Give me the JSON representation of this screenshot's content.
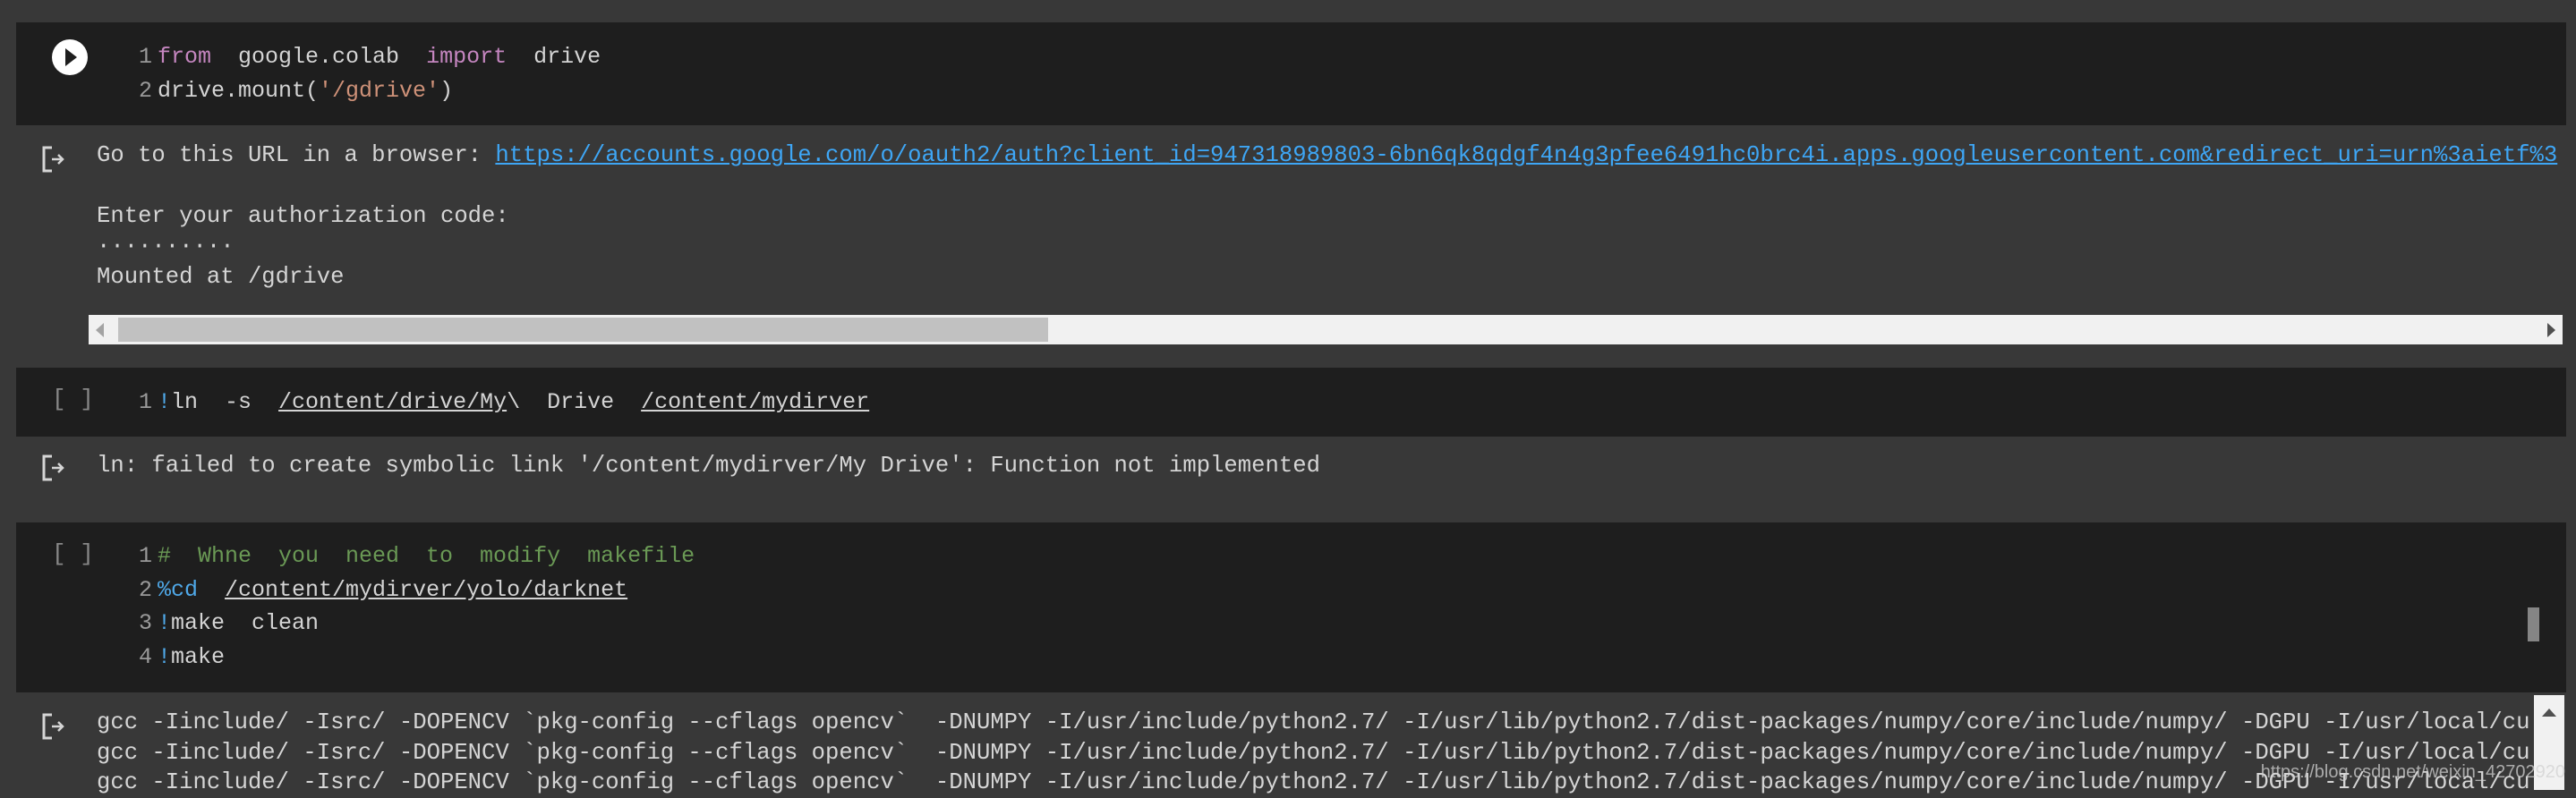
{
  "cells": [
    {
      "state": "run",
      "lines": [
        {
          "n": "1",
          "parts": [
            {
              "t": "from",
              "c": "kw"
            },
            {
              "t": "  google.colab  "
            },
            {
              "t": "import",
              "c": "kw"
            },
            {
              "t": "  drive"
            }
          ]
        },
        {
          "n": "2",
          "parts": [
            {
              "t": "drive.mount("
            },
            {
              "t": "'/gdrive'",
              "c": "str"
            },
            {
              "t": ")"
            }
          ]
        }
      ],
      "output": {
        "prefix": "Go to this URL in a browser: ",
        "link": "https://accounts.google.com/o/oauth2/auth?client_id=947318989803-6bn6qk8qdgf4n4g3pfee6491hc0brc4i.apps.googleusercontent.com&redirect_uri=urn%3aietf%3",
        "prompt": "Enter your authorization code:",
        "masked": "··········",
        "result": "Mounted at /gdrive"
      }
    },
    {
      "state": "[ ]",
      "lines": [
        {
          "n": "1",
          "parts": [
            {
              "t": "!",
              "c": "mag"
            },
            {
              "t": "ln  -s  "
            },
            {
              "t": "/content/drive/My",
              "c": "u"
            },
            {
              "t": "\\  Drive  "
            },
            {
              "t": "/content/mydirver",
              "c": "u"
            }
          ]
        }
      ],
      "output": "ln: failed to create symbolic link '/content/mydirver/My Drive': Function not implemented"
    },
    {
      "state": "[ ]",
      "lines": [
        {
          "n": "1",
          "parts": [
            {
              "t": "#  Whne  you  need  to  modify  makefile",
              "c": "cmt"
            }
          ]
        },
        {
          "n": "2",
          "parts": [
            {
              "t": "%cd",
              "c": "mag"
            },
            {
              "t": "  "
            },
            {
              "t": "/content/mydirver/yolo/darknet",
              "c": "u"
            }
          ]
        },
        {
          "n": "3",
          "parts": [
            {
              "t": "!",
              "c": "mag"
            },
            {
              "t": "make  clean"
            }
          ]
        },
        {
          "n": "4",
          "parts": [
            {
              "t": "!",
              "c": "mag"
            },
            {
              "t": "make"
            }
          ]
        }
      ],
      "output": [
        "gcc -Iinclude/ -Isrc/ -DOPENCV `pkg-config --cflags opencv`  -DNUMPY -I/usr/include/python2.7/ -I/usr/lib/python2.7/dist-packages/numpy/core/include/numpy/ -DGPU -I/usr/local/cu",
        "gcc -Iinclude/ -Isrc/ -DOPENCV `pkg-config --cflags opencv`  -DNUMPY -I/usr/include/python2.7/ -I/usr/lib/python2.7/dist-packages/numpy/core/include/numpy/ -DGPU -I/usr/local/cu",
        "gcc -Iinclude/ -Isrc/ -DOPENCV `pkg-config --cflags opencv`  -DNUMPY -I/usr/include/python2.7/ -I/usr/lib/python2.7/dist-packages/numpy/core/include/numpy/ -DGPU -I/usr/local/cu"
      ]
    }
  ],
  "watermark": "https://blog.csdn.net/weixin_42702920",
  "colors": {
    "background": "#383838",
    "cell": "#1e1e1e",
    "keyword": "#c586c0",
    "string": "#ce9178",
    "comment": "#6a9955",
    "magic": "#4fa8e8",
    "link": "#3ea6f5"
  }
}
